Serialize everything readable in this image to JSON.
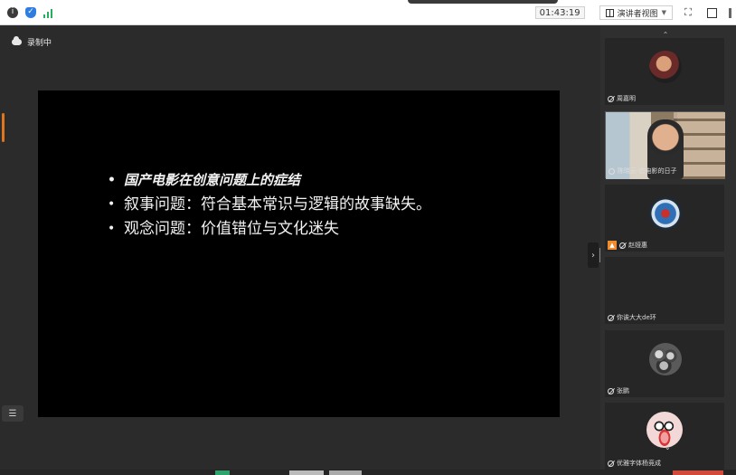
{
  "topbar": {
    "timer": "01:43:19",
    "view_label": "演讲者视图",
    "icons": [
      "info-icon",
      "shield-icon",
      "signal-icon",
      "view-grid-icon",
      "fullscreen-icon",
      "window-icon"
    ]
  },
  "recording": {
    "label": "录制中"
  },
  "slide": {
    "bullets": [
      "国产电影在创意问题上的症结",
      "叙事问题：符合基本常识与逻辑的故事缺失。",
      "观念问题：价值错位与文化迷失"
    ]
  },
  "participants": [
    {
      "name": "周嘉明",
      "muted": true
    },
    {
      "name": "陈晓云-恋电影的日子",
      "muted": false,
      "video": true
    },
    {
      "name": "赵娅惠",
      "muted": true,
      "host_icon": true
    },
    {
      "name": "你诶大大de环",
      "muted": true
    },
    {
      "name": "张鹏",
      "muted": true
    },
    {
      "name": "优雅字体杨竞成",
      "muted": true
    }
  ],
  "colors": {
    "accent": "#e0751d",
    "signal": "#27ae60",
    "shield": "#2f7de1"
  }
}
